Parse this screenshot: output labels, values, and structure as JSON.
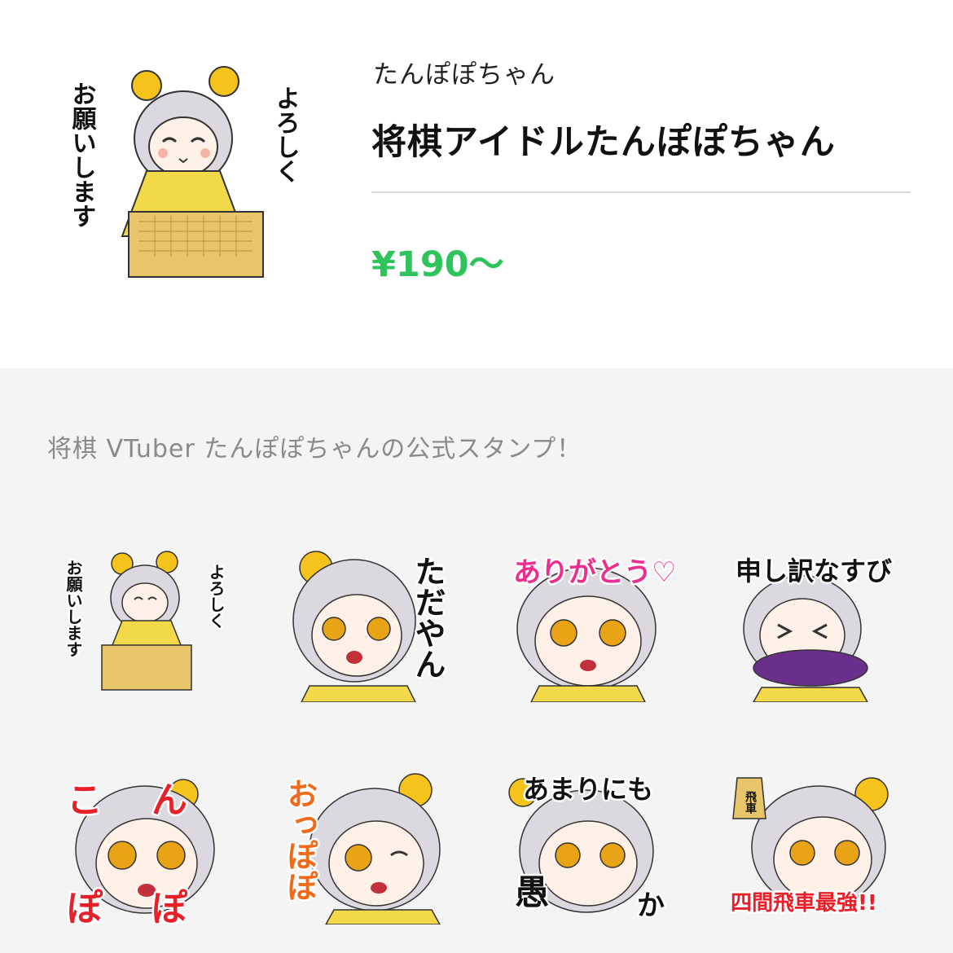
{
  "header": {
    "author": "たんぽぽちゃん",
    "title": "将棋アイドルたんぽぽちゃん",
    "price": "¥190～"
  },
  "description": "将棋 VTuber たんぽぽちゃんの公式スタンプ！",
  "main_sticker": {
    "text_right": "よろしく",
    "text_left": "お願いします"
  },
  "stickers": [
    {
      "lines": [
        "よろしく",
        "お願いします"
      ],
      "color": "#111111"
    },
    {
      "lines": [
        "ただやん"
      ],
      "color": "#111111"
    },
    {
      "lines": [
        "ありがとう♡"
      ],
      "color": "#ec2f8e"
    },
    {
      "lines": [
        "申し訳なすび"
      ],
      "color": "#111111"
    },
    {
      "lines": [
        "こん",
        "ぽぽ"
      ],
      "color": "#e8202a"
    },
    {
      "lines": [
        "おっぽぽ"
      ],
      "color": "#f06a1c"
    },
    {
      "lines": [
        "あまりにも",
        "愚",
        "か"
      ],
      "color": "#111111"
    },
    {
      "lines": [
        "四間飛車最強!!",
        "飛車"
      ],
      "color": "#e8202a"
    }
  ],
  "colors": {
    "price_green": "#2fc45b",
    "hair": "#d9d6de",
    "kimono": "#f2d94a",
    "flower": "#f5c31c",
    "board": "#e9c56a"
  }
}
